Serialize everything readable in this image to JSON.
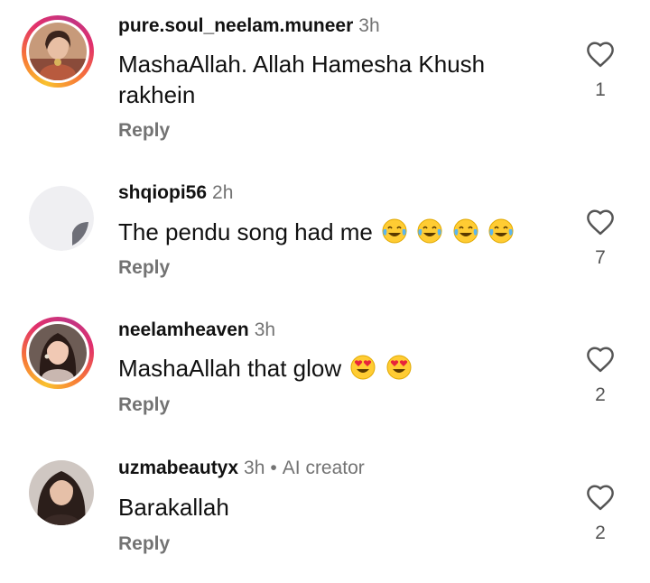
{
  "comments": [
    {
      "username": "pure.soul_neelam.muneer",
      "time": "3h",
      "text_line1": "MashaAllah.  Allah Hamesha Khush",
      "text_line2": "rakhein",
      "reply": "Reply",
      "likes": "1"
    },
    {
      "username": "shqiopi56",
      "time": "2h",
      "text": "The pendu song had me",
      "emoji_icon": "tears-of-joy-icon",
      "reply": "Reply",
      "likes": "7"
    },
    {
      "username": "neelamheaven",
      "time": "3h",
      "text": "MashaAllah that glow",
      "emoji_icon": "heart-eyes-icon",
      "reply": "Reply",
      "likes": "2"
    },
    {
      "username": "uzmabeautyx",
      "time": "3h",
      "separator": "•",
      "badge": "AI creator",
      "text": "Barakallah",
      "reply": "Reply",
      "likes": "2"
    }
  ],
  "colors": {
    "secondary_text": "#737373",
    "story_ring": [
      "#f9c12e",
      "#f77737",
      "#e1306c",
      "#c13584"
    ],
    "emoji_yellow": "#ffcc33"
  }
}
